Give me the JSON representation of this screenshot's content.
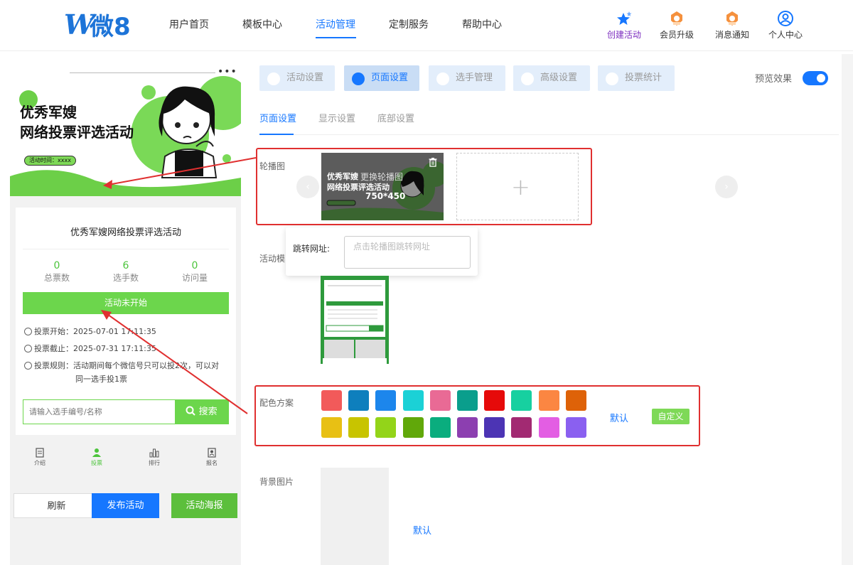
{
  "header": {
    "logo_text": "微8",
    "nav": [
      "用户首页",
      "模板中心",
      "活动管理",
      "定制服务",
      "帮助中心"
    ],
    "nav_active_index": 2,
    "tools": [
      {
        "label": "创建活动",
        "icon": "stars-icon"
      },
      {
        "label": "会员升级",
        "icon": "member-badge-icon"
      },
      {
        "label": "消息通知",
        "icon": "notification-badge-icon"
      },
      {
        "label": "个人中心",
        "icon": "user-circle-icon"
      }
    ]
  },
  "preview": {
    "banner_title_line1": "优秀军嫂",
    "banner_title_line2": "网络投票评选活动",
    "banner_time": "活动时间：xxxx",
    "card_title": "优秀军嫂网络投票评选活动",
    "stats": [
      {
        "value": "0",
        "label": "总票数"
      },
      {
        "value": "6",
        "label": "选手数"
      },
      {
        "value": "0",
        "label": "访问量"
      }
    ],
    "status_button": "活动未开始",
    "vote_start_label": "投票开始：",
    "vote_start": "2025-07-01 17:11:35",
    "vote_end_label": "投票截止：",
    "vote_end": "2025-07-31 17:11:35",
    "rules_label": "投票规则：",
    "rules_line1": "活动期间每个微信号只可以投2次，可以对",
    "rules_line2": "同一选手投1票",
    "search_placeholder": "请输入选手编号/名称",
    "search_button": "搜索",
    "tabbar": [
      "介绍",
      "投票",
      "排行",
      "报名"
    ],
    "tabbar_active_index": 1
  },
  "actions": {
    "refresh": "刷新",
    "publish": "发布活动",
    "poster": "活动海报"
  },
  "settings": {
    "tabs": [
      "活动设置",
      "页面设置",
      "选手管理",
      "高级设置",
      "投票统计"
    ],
    "active_tab_index": 1,
    "preview_label": "预览效果",
    "preview_enabled": true,
    "subtabs": [
      "页面设置",
      "显示设置",
      "底部设置"
    ],
    "active_subtab_index": 0,
    "carousel_label": "轮播图",
    "carousel_change": "更换轮播图",
    "carousel_size": "750*450",
    "carousel_thumb_title_line1": "优秀军嫂",
    "carousel_thumb_title_line2": "网络投票评选活动",
    "jump_url_label": "跳转网址:",
    "jump_url_placeholder": "点击轮播图跳转网址",
    "template_label": "活动模",
    "color_label": "配色方案",
    "colors_row1": [
      "#f25a5a",
      "#0e7fbd",
      "#1c86ec",
      "#1bd1d6",
      "#e96a95",
      "#0a9e8c",
      "#e60a0a",
      "#17d0a0",
      "#fb8642",
      "#de6208"
    ],
    "colors_row2": [
      "#e8c014",
      "#c8c400",
      "#93d419",
      "#61a80a",
      "#0aad7e",
      "#8c3fb0",
      "#4c34b4",
      "#a22a72",
      "#e35ee3",
      "#8a60f0"
    ],
    "color_default": "默认",
    "color_custom": "自定义",
    "bg_label": "背景图片",
    "bg_default": "默认"
  }
}
